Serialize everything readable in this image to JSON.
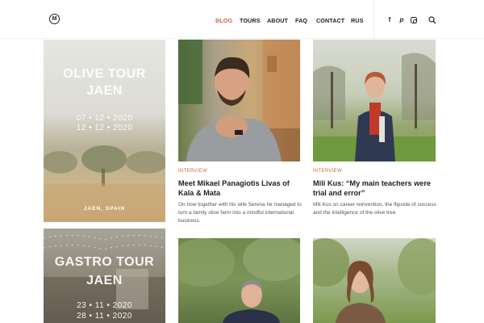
{
  "header": {
    "logo_letter": "M",
    "nav": [
      "BLOG",
      "TOURS",
      "ABOUT",
      "FAQ",
      "CONTACT",
      "RUS"
    ],
    "active_nav": "BLOG",
    "social_icons": [
      "facebook-icon",
      "pinterest-icon",
      "instagram-icon"
    ],
    "facebook_glyph": "f",
    "pinterest_glyph": "p"
  },
  "colors": {
    "accent": "#c96b3a",
    "text": "#222222"
  },
  "tours": [
    {
      "title_line1": "OLIVE TOUR",
      "title_line2": "JAEN",
      "date1": "07 • 12 • 2020",
      "date2": "12 • 12 • 2020",
      "location": "JAEN, SPAIN"
    },
    {
      "title_line1": "GASTRO TOUR",
      "title_line2": "JAEN",
      "date1": "23 • 11 • 2020",
      "date2": "28 • 11 • 2020"
    }
  ],
  "posts": [
    {
      "category": "INTERVIEW",
      "title_line1": "Meet Mikael Panagiotis Livas of",
      "title_line2": "Kala & Mata",
      "excerpt_line1": "On how together with his wife Serena he managed to",
      "excerpt_line2": "turn a family olive farm into a mindful international",
      "excerpt_line3": "business."
    },
    {
      "category": "INTERVIEW",
      "title_line1": "Mili Kus: “My main teachers were",
      "title_line2": "trial and error”",
      "excerpt_line1": "Mili Kus on career reinvention, the flipside of success",
      "excerpt_line2": "and the intelligence of the olive tree"
    }
  ]
}
